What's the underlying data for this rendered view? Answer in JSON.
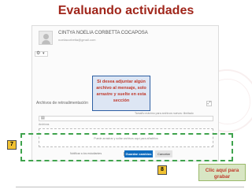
{
  "slide": {
    "title": "Evaluando actividades"
  },
  "user": {
    "name": "CINTYA NOELIA CORBETTA COCAPOSA",
    "email": "noeliacorbetta@gmail.com"
  },
  "form": {
    "section_label": "Archivos de retroalimentación",
    "max_size_label": "Tamaño máximo para archivos nuevos: ilimitado",
    "files_folder": "Archivos",
    "dropzone_text": "Puede arrastrar y soltar archivos aquí para añadirlos",
    "notify_label": "Notificar a los estudiantes",
    "save_label": "Guardar cambios",
    "cancel_label": "Cancelar"
  },
  "callouts": {
    "attach_hint": "Si desea adjuntar algún archivo al mensaje, solo arrastre y suelte en esta sección",
    "save_hint": "Clic aquí para grabar"
  },
  "steps": {
    "step_7": "7",
    "step_8": "8"
  },
  "colors": {
    "title": "#a0261b",
    "save_button": "#0f6cbf",
    "frame": "#3fa34d",
    "badge": "#f1c232",
    "callout_text": "#c0392b"
  }
}
